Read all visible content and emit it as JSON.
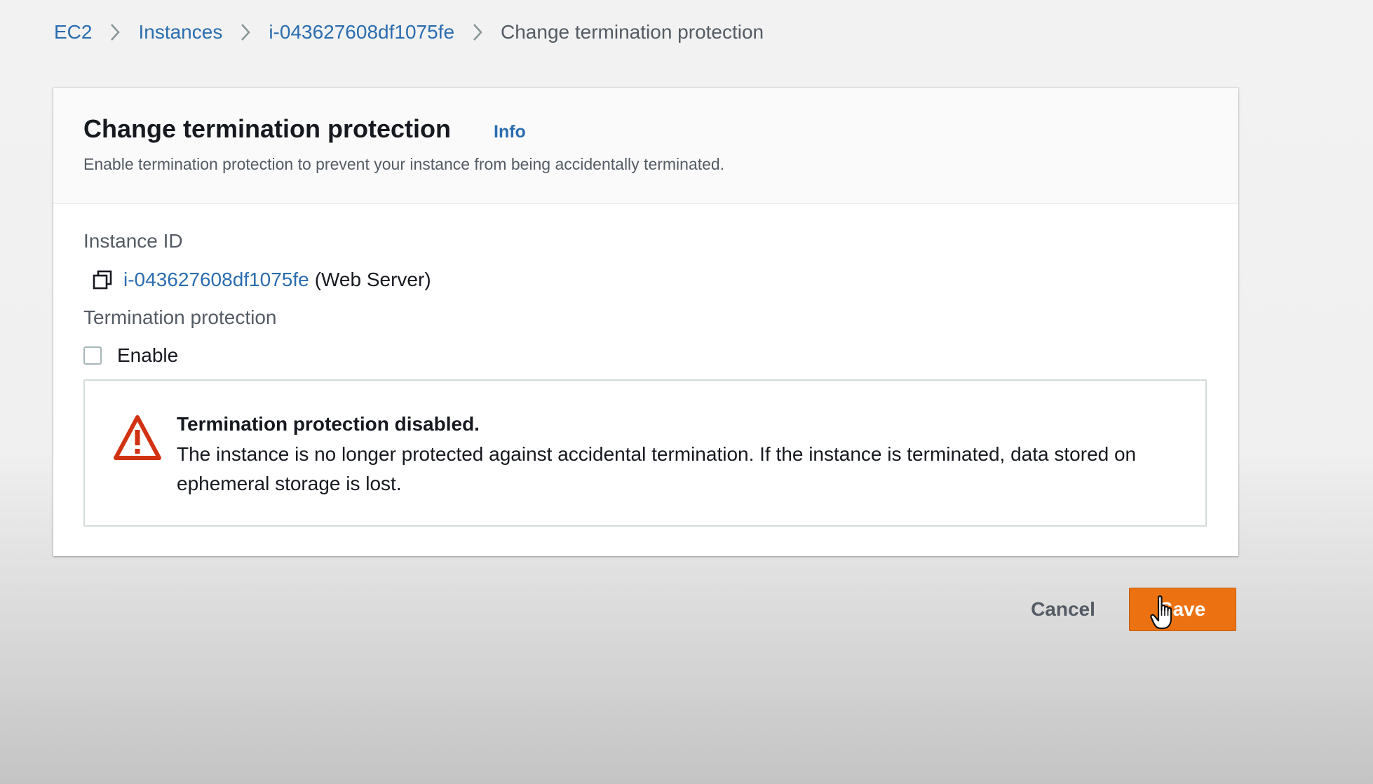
{
  "breadcrumb": {
    "items": [
      {
        "label": "EC2",
        "link": true
      },
      {
        "label": "Instances",
        "link": true
      },
      {
        "label": "i-043627608df1075fe",
        "link": true
      },
      {
        "label": "Change termination protection",
        "link": false
      }
    ],
    "separator_icon": "chevron-right-icon"
  },
  "card": {
    "title": "Change termination protection",
    "info_label": "Info",
    "description": "Enable termination protection to prevent your instance from being accidentally terminated."
  },
  "instance": {
    "label": "Instance ID",
    "id": "i-043627608df1075fe",
    "name": "(Web Server)",
    "copy_icon": "copy-icon"
  },
  "termination": {
    "label": "Termination protection",
    "checkbox_label": "Enable",
    "checked": false
  },
  "alert": {
    "icon": "warning-icon",
    "title": "Termination protection disabled.",
    "body": "The instance is no longer protected against accidental termination. If the instance is terminated, data stored on ephemeral storage is lost."
  },
  "actions": {
    "cancel_label": "Cancel",
    "save_label": "Save"
  },
  "colors": {
    "link": "#2a6db0",
    "primary_button": "#ec7211",
    "warning": "#d13212",
    "muted_text": "#545b64"
  }
}
